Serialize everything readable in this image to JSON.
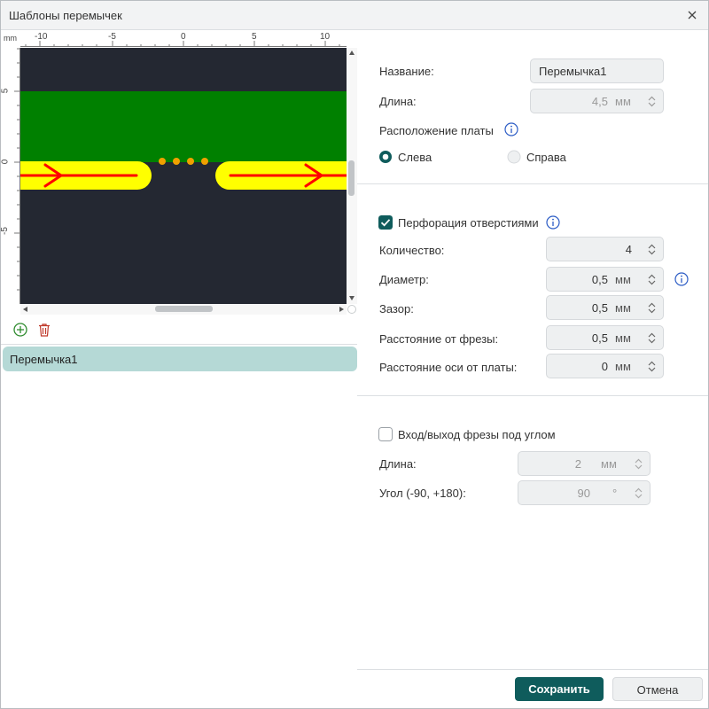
{
  "window": {
    "title": "Шаблоны перемычек"
  },
  "ruler": {
    "unit": "mm",
    "x_ticks": [
      "-10",
      "-5",
      "0",
      "5",
      "10"
    ],
    "y_ticks": [
      "5",
      "0",
      "-5"
    ]
  },
  "colors": {
    "board": "#008000",
    "background": "#242832",
    "track": "#ffff00",
    "arrow": "#ff0000",
    "holes": "#f0a000",
    "accent": "#0f5c5c",
    "list_selected": "#b5d9d6"
  },
  "toolbar": {
    "add_icon": "plus-circle-icon",
    "delete_icon": "trash-icon"
  },
  "templates": [
    {
      "name": "Перемычка1"
    }
  ],
  "form": {
    "name": {
      "label": "Название:",
      "value": "Перемычка1"
    },
    "length": {
      "label": "Длина:",
      "value": "4,5",
      "unit": "мм"
    },
    "placement": {
      "label": "Расположение платы",
      "left": "Слева",
      "right": "Справа",
      "selected": "left"
    },
    "perforation": {
      "label": "Перфорация отверстиями",
      "checked": true
    },
    "count": {
      "label": "Количество:",
      "value": "4"
    },
    "diameter": {
      "label": "Диаметр:",
      "value": "0,5",
      "unit": "мм"
    },
    "gap": {
      "label": "Зазор:",
      "value": "0,5",
      "unit": "мм"
    },
    "mill_distance": {
      "label": "Расстояние от фрезы:",
      "value": "0,5",
      "unit": "мм"
    },
    "axis_distance": {
      "label": "Расстояние оси от платы:",
      "value": "0",
      "unit": "мм"
    },
    "angled": {
      "label": "Вход/выход фрезы под углом",
      "checked": false
    },
    "angled_length": {
      "label": "Длина:",
      "value": "2",
      "unit": "мм"
    },
    "angle": {
      "label": "Угол (-90, +180):",
      "value": "90",
      "unit": "°"
    }
  },
  "buttons": {
    "save": "Сохранить",
    "cancel": "Отмена"
  }
}
